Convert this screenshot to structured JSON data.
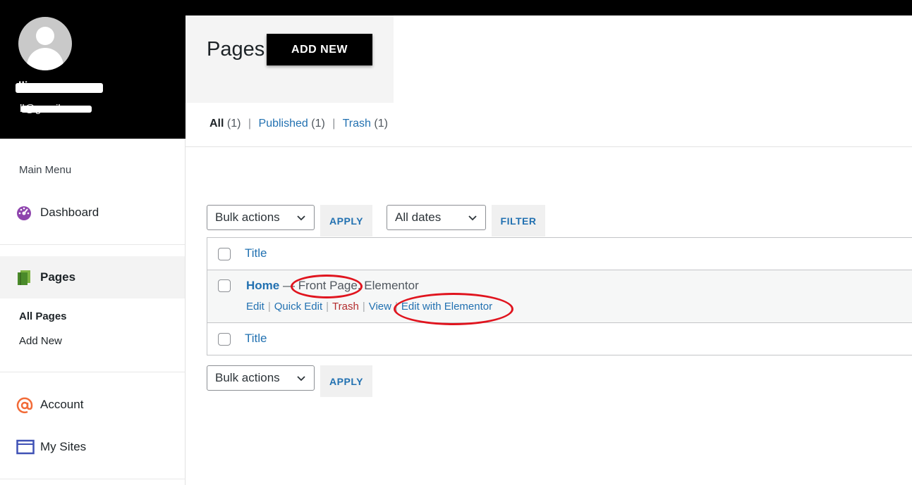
{
  "sidebar": {
    "profile": {
      "username": "lliever...",
      "email": "ll@gmail.com"
    },
    "menu_heading": "Main Menu",
    "items": [
      {
        "label": "Dashboard",
        "icon": "dashboard-gauge-icon",
        "color": "#8e44ad"
      },
      {
        "label": "Pages",
        "icon": "pages-icon",
        "color": "#5a9e3b"
      },
      {
        "label": "Account",
        "icon": "at-sign-icon",
        "color": "#f26b38"
      },
      {
        "label": "My Sites",
        "icon": "browser-window-icon",
        "color": "#3f51b5"
      }
    ],
    "pages_submenu": [
      "All Pages",
      "Add New"
    ]
  },
  "header": {
    "title": "Pages",
    "add_new_label": "ADD NEW"
  },
  "views": {
    "all_label": "All",
    "all_count": "(1)",
    "published_label": "Published",
    "published_count": "(1)",
    "trash_label": "Trash",
    "trash_count": "(1)",
    "separator": "|"
  },
  "filters": {
    "bulk_actions": "Bulk actions",
    "apply_label": "APPLY",
    "dates": "All dates",
    "filter_label": "FILTER"
  },
  "table": {
    "column_title": "Title",
    "rows": [
      {
        "title": "Home",
        "dash": " — ",
        "state1": "Front Page",
        "state_sep": ", ",
        "state2": "Elementor",
        "actions": {
          "edit": "Edit",
          "quick_edit": "Quick Edit",
          "trash": "Trash",
          "view": "View",
          "edit_elementor": "Edit with Elementor",
          "separator": "|"
        }
      }
    ]
  },
  "colors": {
    "link": "#2271b1",
    "trash": "#b32d2e",
    "annotation": "#e0141e"
  }
}
